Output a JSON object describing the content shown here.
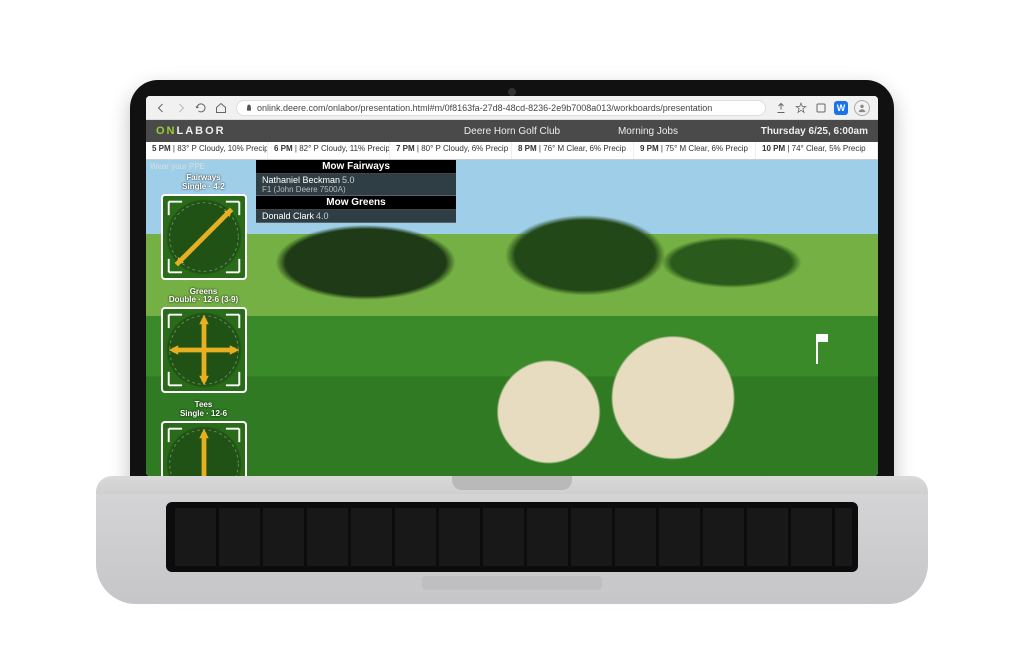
{
  "browser": {
    "url": "onlink.deere.com/onlabor/presentation.html#m/0f8163fa-27d8-48cd-8236-2e9b7008a013/workboards/presentation"
  },
  "header": {
    "logo_on": "ON",
    "logo_rest": "LABOR",
    "club": "Deere Horn Golf Club",
    "shift": "Morning Jobs",
    "datetime": "Thursday 6/25, 6:00am"
  },
  "ppe_note": "Wear your PPE",
  "weather": [
    {
      "time": "5 PM",
      "detail": "83° P Cloudy, 10% Precip"
    },
    {
      "time": "6 PM",
      "detail": "82° P Cloudy, 11% Precip"
    },
    {
      "time": "7 PM",
      "detail": "80° P Cloudy, 6% Precip"
    },
    {
      "time": "8 PM",
      "detail": "76° M Clear, 6% Precip"
    },
    {
      "time": "9 PM",
      "detail": "75° M Clear, 6% Precip"
    },
    {
      "time": "10 PM",
      "detail": "74° Clear, 5% Precip"
    }
  ],
  "sidebar": [
    {
      "title": "Fairways",
      "sub": "Single · 4-2"
    },
    {
      "title": "Greens",
      "sub": "Double · 12-6 (3-9)"
    },
    {
      "title": "Tees",
      "sub": "Single · 12-6"
    }
  ],
  "jobs": [
    {
      "title": "Mow Fairways",
      "rows": [
        {
          "name": "Nathaniel Beckman",
          "hours": "5.0",
          "sub": "F1 (John Deere 7500A)"
        }
      ]
    },
    {
      "title": "Mow Greens",
      "rows": [
        {
          "name": "Donald Clark",
          "hours": "4.0",
          "sub": ""
        }
      ]
    }
  ]
}
